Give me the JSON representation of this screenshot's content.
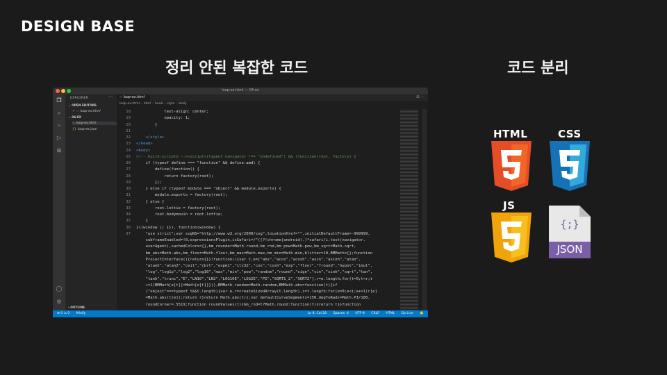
{
  "slide": {
    "logo": "DESIGN BASE",
    "heading_left": "정리 안된 복잡한 코드",
    "heading_right": "코드 분리"
  },
  "window": {
    "title": "loop-ex.html — 04-ex"
  },
  "sidebar": {
    "title": "EXPLORER",
    "more": "···",
    "open_editors_label": "OPEN EDITORS",
    "open_editor_file": "loop-ex.html",
    "folder_label": "04-EX",
    "files": [
      "loop-ex.html",
      "loop-ex.json"
    ],
    "outline_label": "OUTLINE"
  },
  "editor": {
    "tab_label": "loop-ex.html",
    "breadcrumbs": [
      "loop-ex.html",
      "html",
      "head",
      "style",
      "body"
    ]
  },
  "code_lines": [
    {
      "n": "18",
      "t": "            text-align: center;"
    },
    {
      "n": "19",
      "t": "            opacity: 1;"
    },
    {
      "n": "20",
      "t": "        }"
    },
    {
      "n": "21",
      "t": ""
    },
    {
      "n": "22",
      "t": "    </style>"
    },
    {
      "n": "23",
      "t": "</head>"
    },
    {
      "n": "24",
      "t": "<body>"
    },
    {
      "n": "25",
      "t": "<!-- build:scripto --><script>(typeof navigator !== \"undefined\") && (function(root, factory) {"
    },
    {
      "n": "26",
      "t": "    if (typeof define === \"function\" && define.amd) {"
    },
    {
      "n": "27",
      "t": "        define(function() {"
    },
    {
      "n": "28",
      "t": "            return factory(root);"
    },
    {
      "n": "29",
      "t": "        });"
    },
    {
      "n": "30",
      "t": "    } else if (typeof module === \"object\" && module.exports) {"
    },
    {
      "n": "31",
      "t": "        module.exports = factory(root);"
    },
    {
      "n": "32",
      "t": "    } else {"
    },
    {
      "n": "33",
      "t": "        root.lottie = factory(root);"
    },
    {
      "n": "34",
      "t": "        root.bodymovin = root.lottie;"
    },
    {
      "n": "35",
      "t": "    }"
    },
    {
      "n": "36",
      "t": "}((window || {}), function(window) {"
    },
    {
      "n": "37",
      "t": "    \"use strict\";var svgNS=\"http://www.w3.org/2000/svg\",locationHref=\"\",initialDefaultFrame=-999999,"
    },
    {
      "n": "",
      "t": "    subframeEnabled=!0,expressionsPlugin,isSafari=/^((?!chrome|android).)*safari/i.test(navigator."
    },
    {
      "n": "",
      "t": "    userAgent),cachedColors={},bm_rounder=Math.round,bm_rnd,bm_pow=Math.pow,bm_sqrt=Math.sqrt,"
    },
    {
      "n": "",
      "t": "    bm_abs=Math.abs,bm_floor=Math.floor,bm_max=Math.max,bm_min=Math.min,blitter=10,BMMath={};function"
    },
    {
      "n": "",
      "t": "    ProjectInterface(){return{}}!function(){var t,e=[\"abs\",\"acos\",\"acosh\",\"asin\",\"asinh\",\"atan\","
    },
    {
      "n": "",
      "t": "    \"atanh\",\"atan2\",\"ceil\",\"cbrt\",\"expm1\",\"clz32\",\"cos\",\"cosh\",\"exp\",\"floor\",\"fround\",\"hypot\",\"imul\","
    },
    {
      "n": "",
      "t": "    \"log\",\"log1p\",\"log2\",\"log10\",\"max\",\"min\",\"pow\",\"random\",\"round\",\"sign\",\"sin\",\"sinh\",\"sqrt\",\"tan\","
    },
    {
      "n": "",
      "t": "    \"tanh\",\"trunc\",\"E\",\"LN10\",\"LN2\",\"LOG10E\",\"LOG2E\",\"PI\",\"SQRT1_2\",\"SQRT2\"],r=e.length;for(t=0;t<r;t"
    },
    {
      "n": "",
      "t": "    +=1)BMMath[e[t]]=Math[e[t]]}(),BMMath.random=Math.random,BMMath.abs=function(t){if"
    },
    {
      "n": "",
      "t": "    (\"object\"===typeof t&&t.length){var e,r=createSizedArray(t.length),i=t.length;for(e=0;e<i;e+=1)r[e]"
    },
    {
      "n": "",
      "t": "    =Math.abs(t[e]);return r}return Math.abs(t)};var defaultCurveSegments=150,degToRads=Math.PI/180,"
    },
    {
      "n": "",
      "t": "    roundCorner=.5519;function roundValues(t){bm_rnd=t?Math.round:function(t){return t}}function"
    }
  ],
  "statusbar": {
    "left_errors": "⊗ 0 ⚠ 0",
    "left_extra": "Minify",
    "position": "Ln 8, Col 26",
    "spaces": "Spaces: 4",
    "encoding": "UTF-8",
    "eol": "CRLF",
    "language": "HTML",
    "go_live": "Go Live"
  },
  "icons": {
    "html_label": "HTML",
    "css_label": "CSS",
    "js_label": "JS",
    "json_label": "JSON",
    "html_color": "#e44d26",
    "css_color": "#1572b6",
    "js_color": "#f0a30a"
  }
}
